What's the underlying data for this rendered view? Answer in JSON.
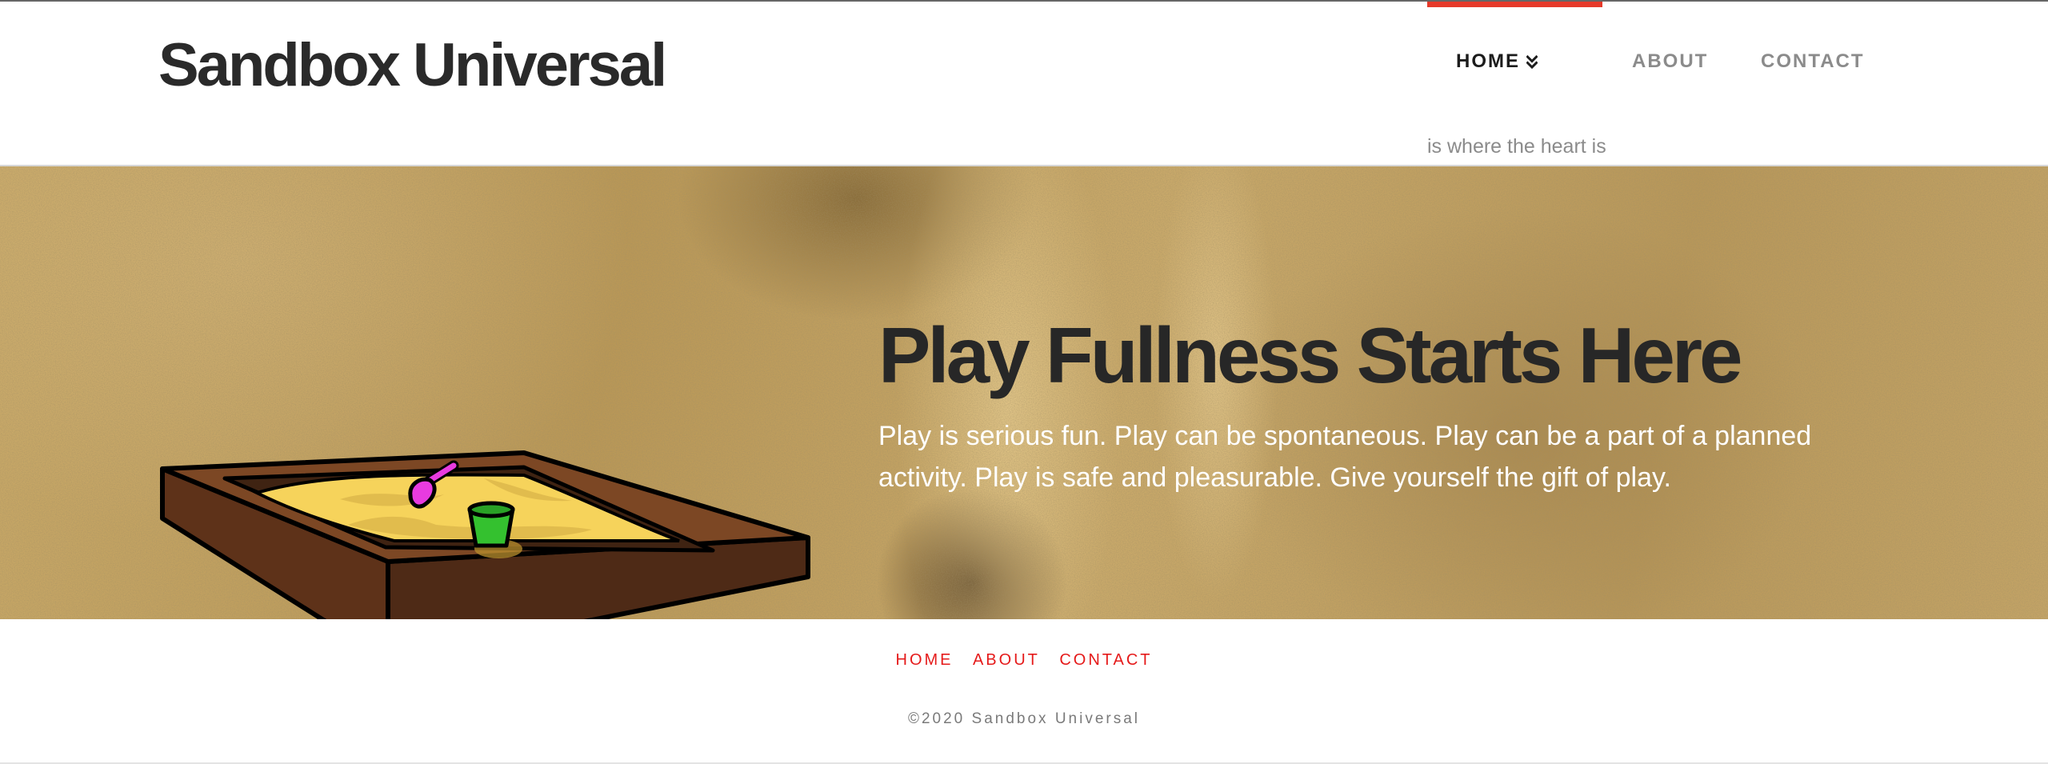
{
  "site": {
    "title": "Sandbox Universal",
    "tagline": "is where the heart is"
  },
  "nav": {
    "items": [
      {
        "label": "HOME",
        "active": true,
        "icon": "chevron-double-down-icon"
      },
      {
        "label": "ABOUT",
        "active": false
      },
      {
        "label": "CONTACT",
        "active": false
      }
    ]
  },
  "hero": {
    "heading": "Play Fullness Starts Here",
    "text": "Play is serious fun. Play can be spontaneous. Play can be a part of a planned activity. Play is safe and pleasurable. Give yourself the gift of play.",
    "illustration": "sandbox-icon"
  },
  "footer": {
    "links": [
      "HOME",
      "ABOUT",
      "CONTACT"
    ],
    "copyright": "©2020 Sandbox Universal"
  },
  "colors": {
    "accent": "#e63929",
    "footer_link": "#e51a1a",
    "title": "#2a2a2a",
    "nav_inactive": "#8b8b8b",
    "sand": "#bd9c62"
  }
}
